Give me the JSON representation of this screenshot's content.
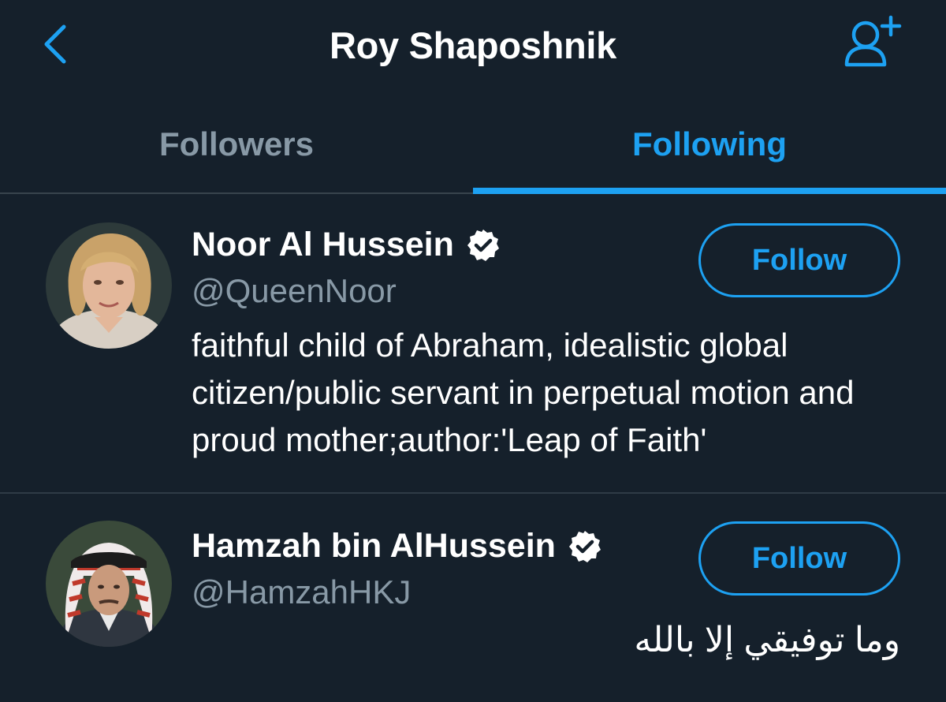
{
  "header": {
    "title": "Roy Shaposhnik",
    "back_icon": "chevron-left-icon",
    "add_user_icon": "add-user-icon"
  },
  "tabs": [
    {
      "label": "Followers",
      "active": false
    },
    {
      "label": "Following",
      "active": true
    }
  ],
  "users": [
    {
      "name": "Noor Al Hussein",
      "handle": "@QueenNoor",
      "verified": true,
      "bio": "faithful child of Abraham, idealistic global citizen/public servant in perpetual motion and proud mother;author:'Leap of Faith'",
      "button_label": "Follow"
    },
    {
      "name": "Hamzah bin AlHussein",
      "handle": "@HamzahHKJ",
      "verified": true,
      "bio": "وما توفيقي إلا بالله",
      "button_label": "Follow"
    }
  ],
  "colors": {
    "background": "#15202b",
    "accent": "#1da1f2",
    "secondary_text": "#8899a6",
    "divider": "#38444d"
  }
}
